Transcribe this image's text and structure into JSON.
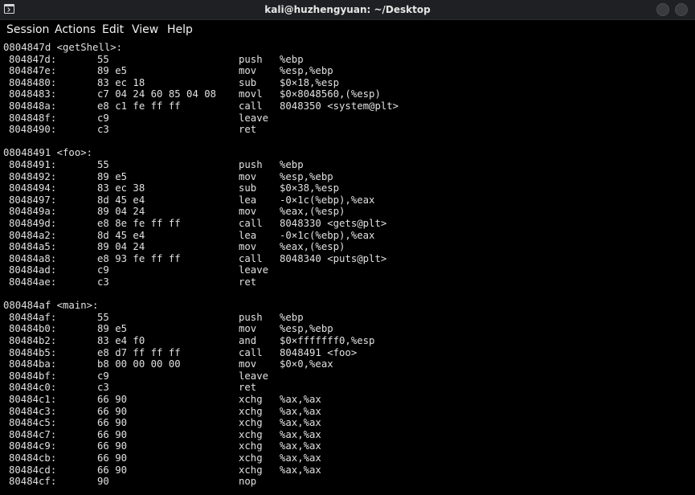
{
  "window": {
    "title": "kali@huzhengyuan: ~/Desktop",
    "icon": "terminal-icon"
  },
  "menu": [
    "Session",
    "Actions",
    "Edit",
    "View",
    "Help"
  ],
  "terminal": {
    "lines": [
      {
        "kind": "label",
        "text": "0804847d <getShell>:"
      },
      {
        "kind": "insn",
        "addr": "804847d:",
        "bytes": "55",
        "mnemonic": "push",
        "operands": "%ebp"
      },
      {
        "kind": "insn",
        "addr": "804847e:",
        "bytes": "89 e5",
        "mnemonic": "mov",
        "operands": "%esp,%ebp"
      },
      {
        "kind": "insn",
        "addr": "8048480:",
        "bytes": "83 ec 18",
        "mnemonic": "sub",
        "operands": "$0×18,%esp"
      },
      {
        "kind": "insn",
        "addr": "8048483:",
        "bytes": "c7 04 24 60 85 04 08",
        "mnemonic": "movl",
        "operands": "$0×8048560,(%esp)"
      },
      {
        "kind": "insn",
        "addr": "804848a:",
        "bytes": "e8 c1 fe ff ff",
        "mnemonic": "call",
        "operands": "8048350 <system@plt>"
      },
      {
        "kind": "insn",
        "addr": "804848f:",
        "bytes": "c9",
        "mnemonic": "leave",
        "operands": ""
      },
      {
        "kind": "insn",
        "addr": "8048490:",
        "bytes": "c3",
        "mnemonic": "ret",
        "operands": ""
      },
      {
        "kind": "blank"
      },
      {
        "kind": "label",
        "text": "08048491 <foo>:"
      },
      {
        "kind": "insn",
        "addr": "8048491:",
        "bytes": "55",
        "mnemonic": "push",
        "operands": "%ebp"
      },
      {
        "kind": "insn",
        "addr": "8048492:",
        "bytes": "89 e5",
        "mnemonic": "mov",
        "operands": "%esp,%ebp"
      },
      {
        "kind": "insn",
        "addr": "8048494:",
        "bytes": "83 ec 38",
        "mnemonic": "sub",
        "operands": "$0×38,%esp"
      },
      {
        "kind": "insn",
        "addr": "8048497:",
        "bytes": "8d 45 e4",
        "mnemonic": "lea",
        "operands": "-0×1c(%ebp),%eax"
      },
      {
        "kind": "insn",
        "addr": "804849a:",
        "bytes": "89 04 24",
        "mnemonic": "mov",
        "operands": "%eax,(%esp)"
      },
      {
        "kind": "insn",
        "addr": "804849d:",
        "bytes": "e8 8e fe ff ff",
        "mnemonic": "call",
        "operands": "8048330 <gets@plt>"
      },
      {
        "kind": "insn",
        "addr": "80484a2:",
        "bytes": "8d 45 e4",
        "mnemonic": "lea",
        "operands": "-0×1c(%ebp),%eax"
      },
      {
        "kind": "insn",
        "addr": "80484a5:",
        "bytes": "89 04 24",
        "mnemonic": "mov",
        "operands": "%eax,(%esp)"
      },
      {
        "kind": "insn",
        "addr": "80484a8:",
        "bytes": "e8 93 fe ff ff",
        "mnemonic": "call",
        "operands": "8048340 <puts@plt>"
      },
      {
        "kind": "insn",
        "addr": "80484ad:",
        "bytes": "c9",
        "mnemonic": "leave",
        "operands": ""
      },
      {
        "kind": "insn",
        "addr": "80484ae:",
        "bytes": "c3",
        "mnemonic": "ret",
        "operands": ""
      },
      {
        "kind": "blank"
      },
      {
        "kind": "label",
        "text": "080484af <main>:"
      },
      {
        "kind": "insn",
        "addr": "80484af:",
        "bytes": "55",
        "mnemonic": "push",
        "operands": "%ebp"
      },
      {
        "kind": "insn",
        "addr": "80484b0:",
        "bytes": "89 e5",
        "mnemonic": "mov",
        "operands": "%esp,%ebp"
      },
      {
        "kind": "insn",
        "addr": "80484b2:",
        "bytes": "83 e4 f0",
        "mnemonic": "and",
        "operands": "$0×fffffff0,%esp"
      },
      {
        "kind": "insn",
        "addr": "80484b5:",
        "bytes": "e8 d7 ff ff ff",
        "mnemonic": "call",
        "operands": "8048491 <foo>"
      },
      {
        "kind": "insn",
        "addr": "80484ba:",
        "bytes": "b8 00 00 00 00",
        "mnemonic": "mov",
        "operands": "$0×0,%eax"
      },
      {
        "kind": "insn",
        "addr": "80484bf:",
        "bytes": "c9",
        "mnemonic": "leave",
        "operands": ""
      },
      {
        "kind": "insn",
        "addr": "80484c0:",
        "bytes": "c3",
        "mnemonic": "ret",
        "operands": ""
      },
      {
        "kind": "insn",
        "addr": "80484c1:",
        "bytes": "66 90",
        "mnemonic": "xchg",
        "operands": "%ax,%ax"
      },
      {
        "kind": "insn",
        "addr": "80484c3:",
        "bytes": "66 90",
        "mnemonic": "xchg",
        "operands": "%ax,%ax"
      },
      {
        "kind": "insn",
        "addr": "80484c5:",
        "bytes": "66 90",
        "mnemonic": "xchg",
        "operands": "%ax,%ax"
      },
      {
        "kind": "insn",
        "addr": "80484c7:",
        "bytes": "66 90",
        "mnemonic": "xchg",
        "operands": "%ax,%ax"
      },
      {
        "kind": "insn",
        "addr": "80484c9:",
        "bytes": "66 90",
        "mnemonic": "xchg",
        "operands": "%ax,%ax"
      },
      {
        "kind": "insn",
        "addr": "80484cb:",
        "bytes": "66 90",
        "mnemonic": "xchg",
        "operands": "%ax,%ax"
      },
      {
        "kind": "insn",
        "addr": "80484cd:",
        "bytes": "66 90",
        "mnemonic": "xchg",
        "operands": "%ax,%ax"
      },
      {
        "kind": "insn",
        "addr": "80484cf:",
        "bytes": "90",
        "mnemonic": "nop",
        "operands": ""
      }
    ]
  }
}
